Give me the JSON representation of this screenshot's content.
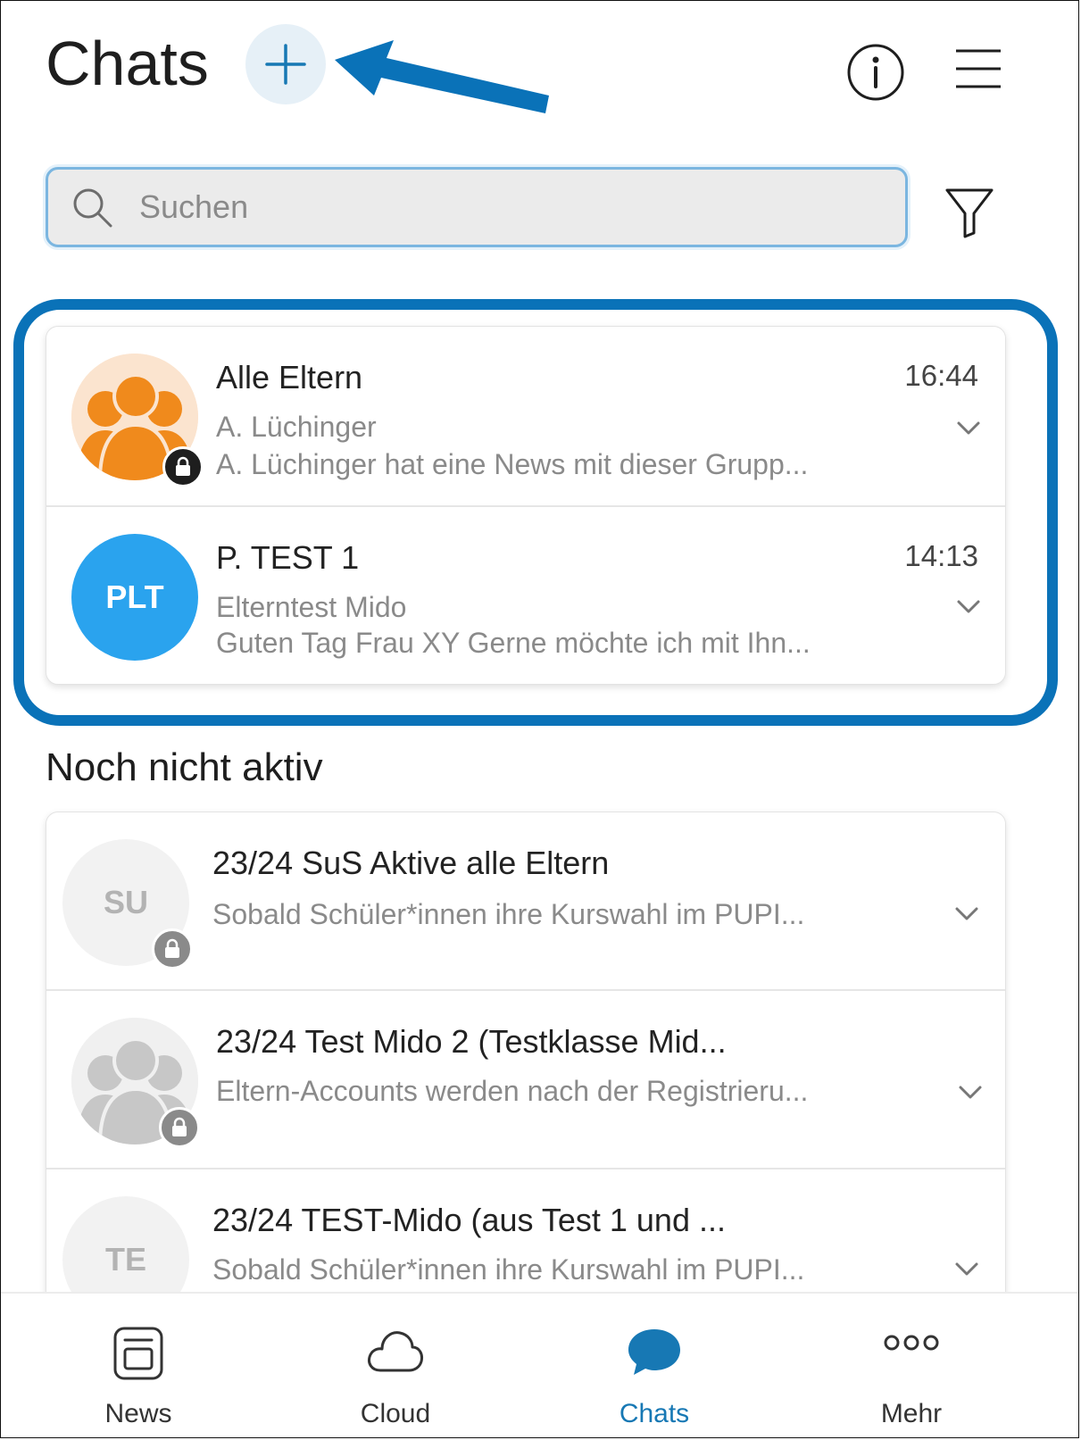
{
  "header": {
    "title": "Chats"
  },
  "search": {
    "placeholder": "Suchen"
  },
  "active_chats": [
    {
      "name": "Alle Eltern",
      "time": "16:44",
      "sender": "A. Lüchinger",
      "preview": "A. Lüchinger hat eine News mit dieser Grupp...",
      "avatar": "group-orange"
    },
    {
      "name": "P. TEST 1",
      "time": "14:13",
      "sender": "Elterntest Mido",
      "preview": "Guten Tag Frau XY Gerne möchte ich mit Ihn...",
      "avatar_initials": "PLT"
    }
  ],
  "inactive_section": {
    "heading": "Noch nicht aktiv",
    "items": [
      {
        "name": "23/24 SuS Aktive alle Eltern",
        "preview": "Sobald Schüler*innen ihre Kurswahl im PUPI...",
        "avatar_initials": "SU"
      },
      {
        "name": "23/24 Test Mido 2 (Testklasse Mid...",
        "preview": "Eltern-Accounts werden nach der Registrieru...",
        "avatar": "group-grey"
      },
      {
        "name": "23/24 TEST-Mido (aus Test 1 und ...",
        "preview": "Sobald Schüler*innen ihre Kurswahl im PUPI...",
        "avatar_initials": "TE"
      }
    ]
  },
  "bottom_nav": {
    "items": [
      {
        "label": "News",
        "icon": "news-icon"
      },
      {
        "label": "Cloud",
        "icon": "cloud-icon"
      },
      {
        "label": "Chats",
        "icon": "chat-bubble-icon",
        "active": true
      },
      {
        "label": "Mehr",
        "icon": "more-dots-icon"
      }
    ]
  },
  "colors": {
    "accent": "#1778b4",
    "annotation": "#0a72b8",
    "avatar_orange": "#f08a1c",
    "avatar_blue": "#2aa3ee",
    "avatar_grey": "#f2f2f2"
  }
}
